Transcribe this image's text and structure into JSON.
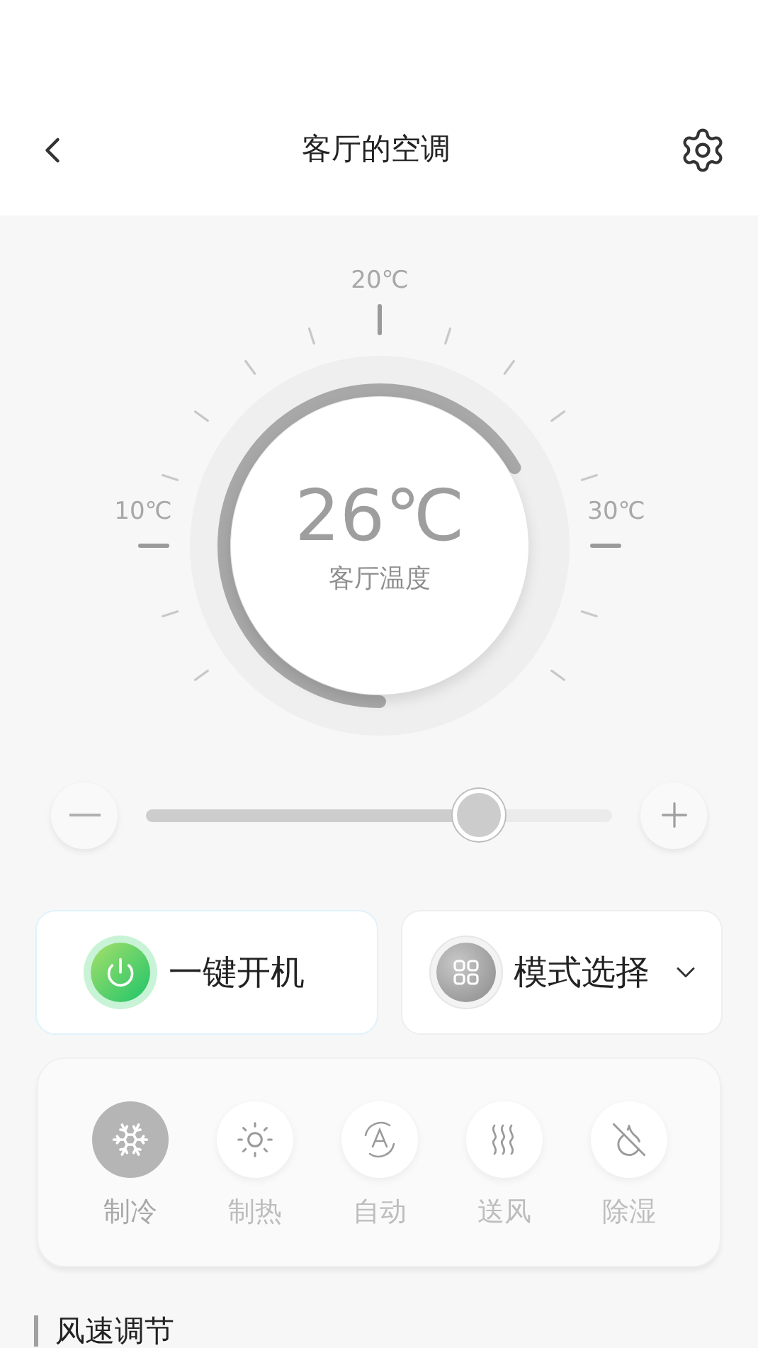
{
  "header": {
    "title": "客厅的空调"
  },
  "dial": {
    "scale_labels": [
      "10℃",
      "20℃",
      "30℃"
    ],
    "temperature": "26℃",
    "caption": "客厅温度"
  },
  "slider": {
    "level": 0.715
  },
  "actions": [
    {
      "kind": "power",
      "label": "一键开机"
    },
    {
      "kind": "mode",
      "label": "模式选择"
    }
  ],
  "modes": [
    {
      "kind": "cool",
      "label": "制冷",
      "selected": true
    },
    {
      "kind": "heat",
      "label": "制热",
      "selected": false
    },
    {
      "kind": "auto",
      "label": "自动",
      "selected": false
    },
    {
      "kind": "fan",
      "label": "送风",
      "selected": false
    },
    {
      "kind": "dry",
      "label": "除湿",
      "selected": false
    }
  ],
  "section": {
    "title": "风速调节"
  }
}
